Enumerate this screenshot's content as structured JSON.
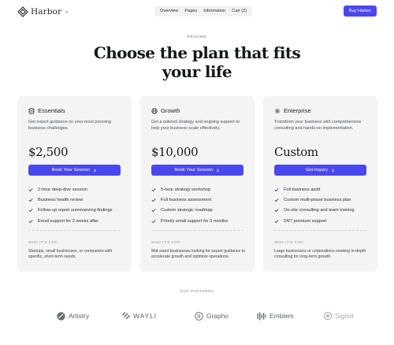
{
  "header": {
    "brand": "Harbor",
    "brand_mark": "™",
    "nav": [
      "Overview",
      "Pages",
      "Information",
      "Cart (2)"
    ],
    "buy_label": "Buy Harbor",
    "accent": "#4b47f0"
  },
  "hero": {
    "eyebrow": "PRICING",
    "title_line1": "Choose the plan that fits",
    "title_line2": "your life"
  },
  "plans": [
    {
      "name": "Essentials",
      "icon": "database-icon",
      "description": "Get expert guidance on your most pressing business challenges.",
      "price": "$2,500",
      "cta": "Book Your Session",
      "features": [
        "2-hour deep-dive session",
        "Business health review",
        "Follow-up report summarizing findings",
        "Email support for 2 weeks after"
      ],
      "who_label": "WHO IT'S FOR:",
      "who_text": "Startups, small businesses, or companies with specific, short-term needs."
    },
    {
      "name": "Growth",
      "icon": "globe-icon",
      "description": "Get a tailored strategy and ongoing support to help your business scale effectively.",
      "price": "$10,000",
      "cta": "Book Your Session",
      "features": [
        "5-hour strategy workshop",
        "Full business assessment",
        "Custom strategic roadmap",
        "Priority email support for 3 months"
      ],
      "who_label": "WHO IT'S FOR:",
      "who_text": "Mid-sized businesses looking for expert guidance to accelerate growth and optimize operations."
    },
    {
      "name": "Enterprise",
      "icon": "sparkle-icon",
      "description": "Transform your business with comprehensive consulting and hands-on implementation.",
      "price": "Custom",
      "cta": "Get inquiry",
      "features": [
        "Full business audit",
        "Custom multi-phase business plan",
        "On-site consulting and team training",
        "24/7 premium support"
      ],
      "who_label": "WHO IT'S FOR:",
      "who_text": "Large businesses or corporations seeking in-depth consulting for long-term growth."
    }
  ],
  "partners": {
    "label": "OUR PARTNERS",
    "items": [
      "Artistry",
      "WAYLI",
      "Grapho",
      "Emblem",
      "Signot"
    ]
  }
}
